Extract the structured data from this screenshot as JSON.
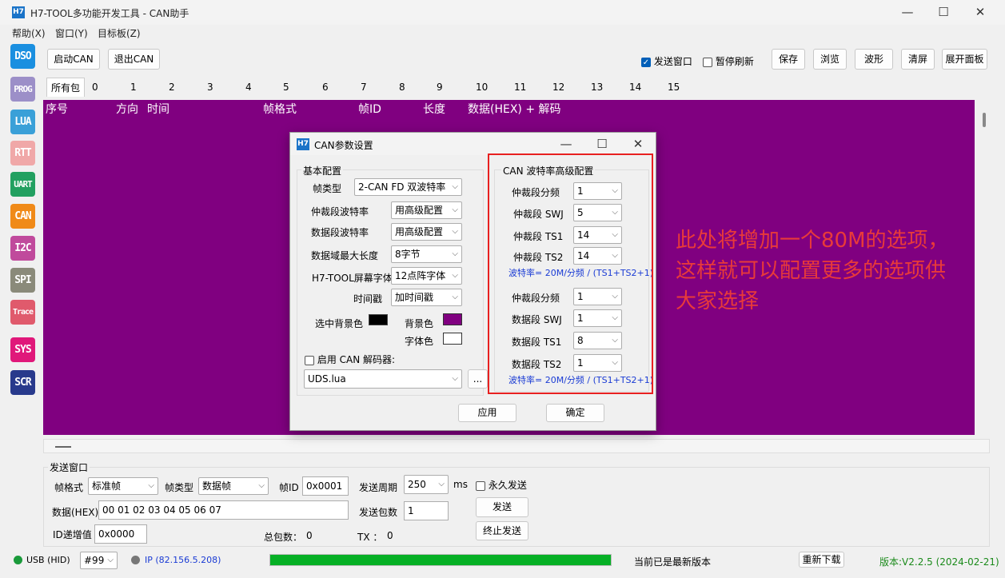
{
  "window": {
    "icon_text": "H7",
    "title": "H7-TOOL多功能开发工具 - CAN助手",
    "minimize": "—",
    "maximize": "☐",
    "close": "✕"
  },
  "menu": [
    "帮助(X)",
    "窗口(Y)",
    "目标板(Z)"
  ],
  "sidebar": [
    {
      "label": "DSO",
      "color": "#1a8fe0"
    },
    {
      "label": "PROG",
      "color": "#9c8fc8"
    },
    {
      "label": "LUA",
      "color": "#3aa0d8"
    },
    {
      "label": "RTT",
      "color": "#f0a8a8"
    },
    {
      "label": "UART",
      "color": "#22a060"
    },
    {
      "label": "CAN",
      "color": "#f08a18"
    },
    {
      "label": "I2C",
      "color": "#c04a9c"
    },
    {
      "label": "SPI",
      "color": "#8a8a7a"
    },
    {
      "label": "Trace",
      "color": "#e05a6c"
    },
    {
      "label": "SYS",
      "color": "#e0187a"
    },
    {
      "label": "SCR",
      "color": "#283a8c"
    }
  ],
  "toolbar": {
    "start_can": "启动CAN",
    "exit_can": "退出CAN",
    "send_window": "发送窗口",
    "pause_refresh": "暂停刷新",
    "save": "保存",
    "browse": "浏览",
    "wave": "波形",
    "clear": "清屏",
    "expand": "展开面板",
    "checkmark": "✓"
  },
  "tabs": [
    "所有包",
    "0",
    "1",
    "2",
    "3",
    "4",
    "5",
    "6",
    "7",
    "8",
    "9",
    "10",
    "11",
    "12",
    "13",
    "14",
    "15"
  ],
  "table_headers": {
    "seq": "序号",
    "dir": "方向",
    "time": "时间",
    "format": "帧格式",
    "id": "帧ID",
    "len": "长度",
    "data": "数据(HEX) + 解码"
  },
  "dialog": {
    "icon_text": "H7",
    "title": "CAN参数设置",
    "minimize": "—",
    "maximize": "☐",
    "close": "✕",
    "basic": {
      "title": "基本配置",
      "frame_type_label": "帧类型",
      "frame_type_value": "2-CAN FD 双波特率",
      "arb_baud_label": "仲裁段波特率",
      "arb_baud_value": "用高级配置",
      "data_baud_label": "数据段波特率",
      "data_baud_value": "用高级配置",
      "max_len_label": "数据域最大长度",
      "max_len_value": "8字节",
      "font_label": "H7-TOOL屏幕字体",
      "font_value": "12点阵字体",
      "timestamp_label": "时间戳",
      "timestamp_value": "加时间戳",
      "sel_bg_label": "选中背景色",
      "bg_label": "背景色",
      "fg_label": "字体色",
      "decoder_label": "启用 CAN 解码器:",
      "decoder_value": "UDS.lua",
      "browse": "..."
    },
    "advanced": {
      "title": "CAN 波特率高级配置",
      "rows": [
        {
          "label": "仲裁段分频",
          "value": "1"
        },
        {
          "label": "仲裁段 SWJ",
          "value": "5"
        },
        {
          "label": "仲裁段 TS1",
          "value": "14"
        },
        {
          "label": "仲裁段 TS2",
          "value": "14"
        },
        {
          "label": "仲裁段分频",
          "value": "1"
        },
        {
          "label": "数据段 SWJ",
          "value": "1"
        },
        {
          "label": "数据段 TS1",
          "value": "8"
        },
        {
          "label": "数据段 TS2",
          "value": "1"
        }
      ],
      "formula1": "波特率= 20M/分频 / (TS1+TS2+1)",
      "formula2": "波特率= 20M/分频 / (TS1+TS2+1)"
    },
    "apply": "应用",
    "ok": "确定"
  },
  "annotation": {
    "text": "此处将增加一个80M的选项，这样就可以配置更多的选项供大家选择",
    "color": "#e83a3a"
  },
  "send": {
    "title": "发送窗口",
    "frame_format_label": "帧格式",
    "frame_format_value": "标准帧",
    "frame_type_label": "帧类型",
    "frame_type_value": "数据帧",
    "frame_id_label": "帧ID",
    "frame_id_value": "0x0001",
    "period_label": "发送周期",
    "period_value": "250",
    "period_unit": "ms",
    "forever_label": "永久发送",
    "data_label": "数据(HEX)",
    "data_value": "00 01 02 03 04 05 06 07",
    "count_label": "发送包数",
    "count_value": "1",
    "send_btn": "发送",
    "stop_btn": "终止发送",
    "id_inc_label": "ID递增值",
    "id_inc_value": "0x0000",
    "total_label": "总包数：",
    "total_value": "0",
    "tx_label": "TX ：",
    "tx_value": "0"
  },
  "status": {
    "usb": "USB (HID)",
    "device": "#99",
    "ip": "IP (82.156.5.208)",
    "progress": 1.0,
    "update_msg": "当前已是最新版本",
    "redownload": "重新下载",
    "version": "版本:V2.2.5 (2024-02-21)"
  }
}
